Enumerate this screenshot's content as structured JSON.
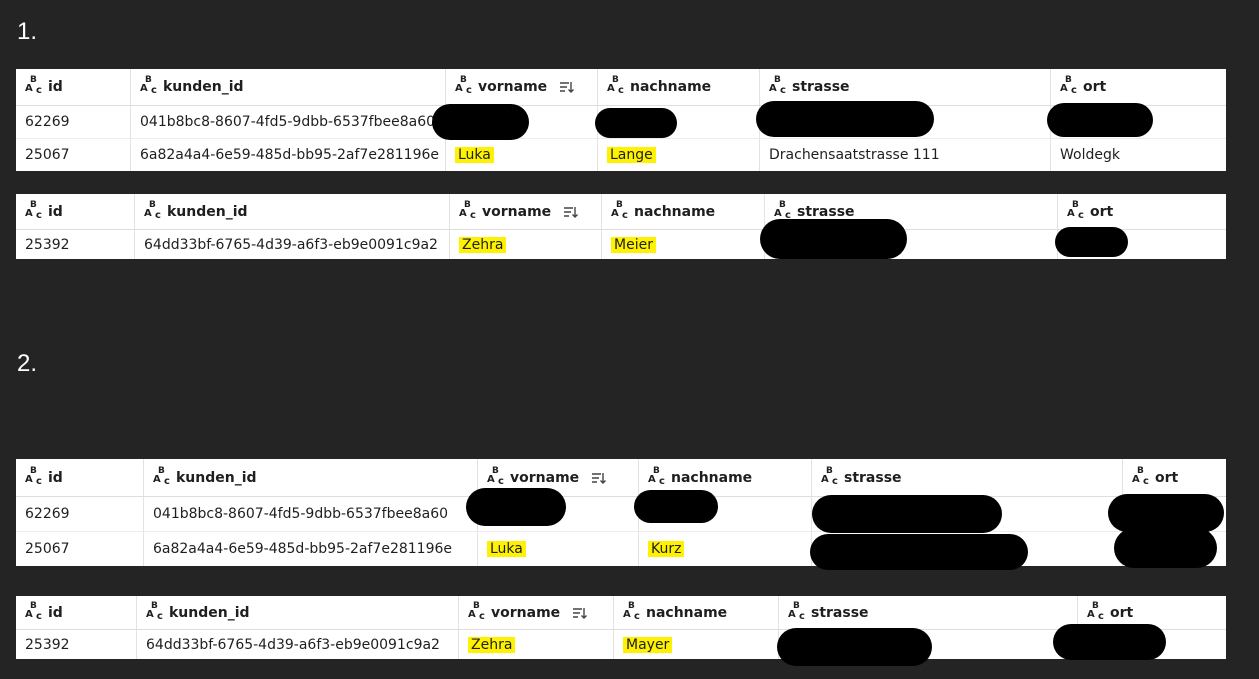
{
  "colors": {
    "background": "#242424",
    "highlight": "#fff200",
    "redaction": "#000000"
  },
  "icons": {
    "column_type": "abc-text-icon",
    "sort": "sort-descending-icon"
  },
  "columns": {
    "id": "id",
    "kunden_id": "kunden_id",
    "vorname": "vorname",
    "nachname": "nachname",
    "strasse": "strasse",
    "ort": "ort"
  },
  "sections": [
    {
      "label": "1.",
      "tables": [
        {
          "rows": [
            {
              "id": "62269",
              "kunden_id": "041b8bc8-8607-4fd5-9dbb-6537fbee8a60",
              "vorname": "",
              "nachname": "",
              "strasse": "",
              "ort": ""
            },
            {
              "id": "25067",
              "kunden_id": "6a82a4a4-6e59-485d-bb95-2af7e281196e",
              "vorname": "Luka",
              "nachname": "Lange",
              "strasse": "Drachensaatstrasse 111",
              "ort": "Woldegk"
            }
          ]
        },
        {
          "rows": [
            {
              "id": "25392",
              "kunden_id": "64dd33bf-6765-4d39-a6f3-eb9e0091c9a2",
              "vorname": "Zehra",
              "nachname": "Meier",
              "strasse": "",
              "ort": ""
            }
          ]
        }
      ]
    },
    {
      "label": "2.",
      "tables": [
        {
          "rows": [
            {
              "id": "62269",
              "kunden_id": "041b8bc8-8607-4fd5-9dbb-6537fbee8a60",
              "vorname": "",
              "nachname": "",
              "strasse": "",
              "ort": ""
            },
            {
              "id": "25067",
              "kunden_id": "6a82a4a4-6e59-485d-bb95-2af7e281196e",
              "vorname": "Luka",
              "nachname": "Kurz",
              "strasse": "",
              "ort": ""
            }
          ]
        },
        {
          "rows": [
            {
              "id": "25392",
              "kunden_id": "64dd33bf-6765-4d39-a6f3-eb9e0091c9a2",
              "vorname": "Zehra",
              "nachname": "Mayer",
              "strasse": "",
              "ort": ""
            }
          ]
        }
      ]
    }
  ]
}
